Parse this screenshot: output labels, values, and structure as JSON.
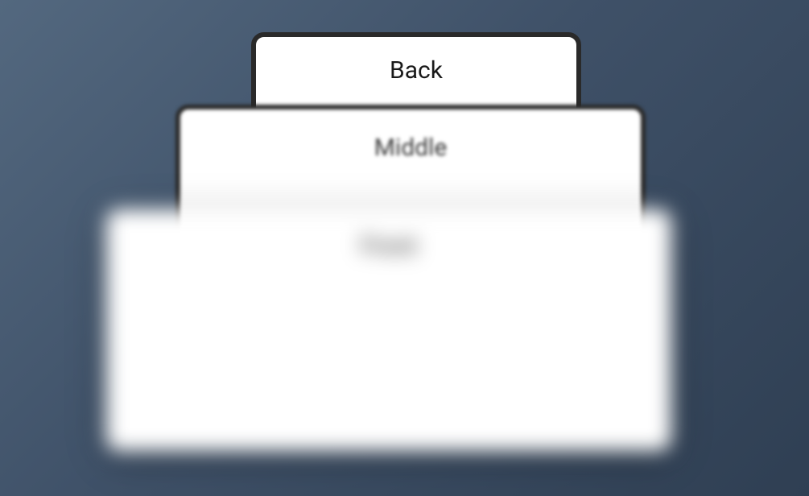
{
  "cards": {
    "back": {
      "label": "Back"
    },
    "middle": {
      "label": "Middle"
    },
    "front": {
      "label": "Front"
    }
  }
}
